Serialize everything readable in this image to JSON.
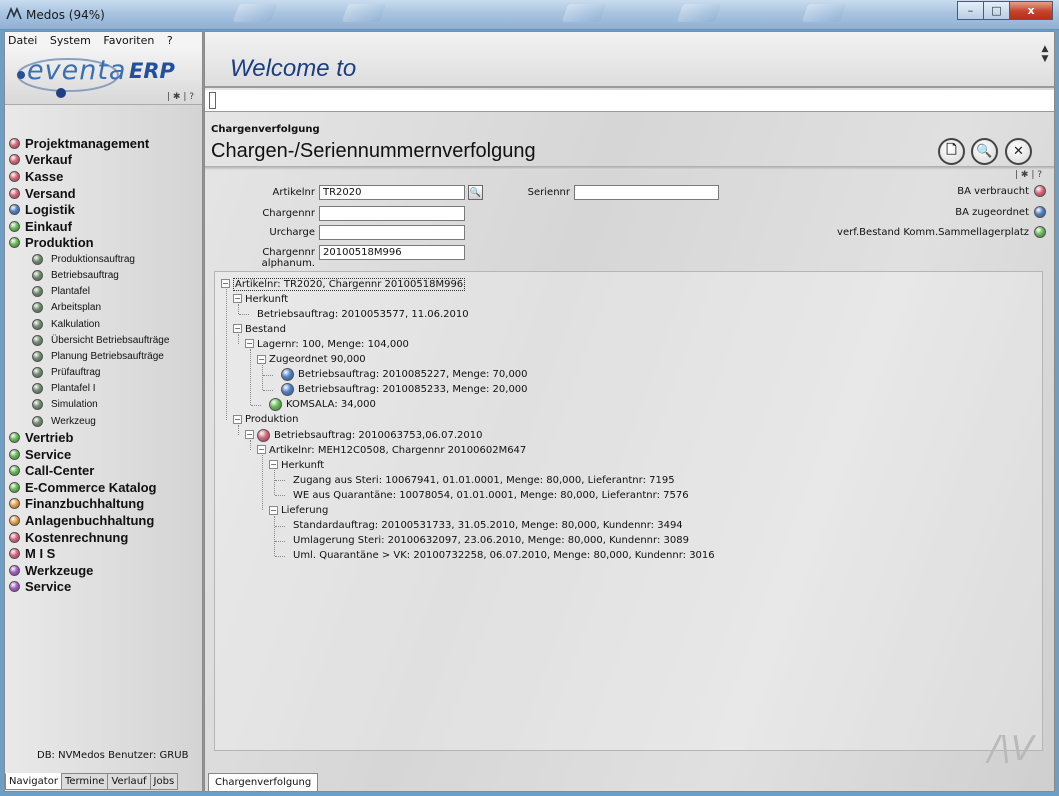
{
  "window": {
    "title": "Medos (94%)",
    "min_symbol": "–",
    "max_symbol": "□",
    "close_symbol": "x"
  },
  "menu": [
    "Datei",
    "System",
    "Favoriten",
    "?"
  ],
  "logo": {
    "brand": "eventa",
    "erp": "ERP"
  },
  "toolstrip": "| ✱ | ?",
  "colors": {
    "pink": "#d9667a",
    "blue": "#4f7fc6",
    "green": "#66bb55",
    "orange": "#e8a24a",
    "purple": "#a85cc3",
    "gray_green": "#6e8f6e"
  },
  "navigator": {
    "items": [
      {
        "label": "Projektmanagement",
        "color": "#d9667a",
        "sub": false
      },
      {
        "label": "Verkauf",
        "color": "#d9667a",
        "sub": false
      },
      {
        "label": "Kasse",
        "color": "#d9667a",
        "sub": false
      },
      {
        "label": "Versand",
        "color": "#d9667a",
        "sub": false
      },
      {
        "label": "Logistik",
        "color": "#4f7fc6",
        "sub": false
      },
      {
        "label": "Einkauf",
        "color": "#66bb55",
        "sub": false
      },
      {
        "label": "Produktion",
        "color": "#66bb55",
        "sub": false
      },
      {
        "label": "Produktionsauftrag",
        "color": "#6e8f6e",
        "sub": true
      },
      {
        "label": "Betriebsauftrag",
        "color": "#6e8f6e",
        "sub": true
      },
      {
        "label": "Plantafel",
        "color": "#6e8f6e",
        "sub": true
      },
      {
        "label": "Arbeitsplan",
        "color": "#6e8f6e",
        "sub": true
      },
      {
        "label": "Kalkulation",
        "color": "#6e8f6e",
        "sub": true
      },
      {
        "label": "Übersicht Betriebsaufträge",
        "color": "#6e8f6e",
        "sub": true
      },
      {
        "label": "Planung Betriebsaufträge",
        "color": "#6e8f6e",
        "sub": true
      },
      {
        "label": "Prüfauftrag",
        "color": "#6e8f6e",
        "sub": true
      },
      {
        "label": "Plantafel I",
        "color": "#6e8f6e",
        "sub": true
      },
      {
        "label": "Simulation",
        "color": "#6e8f6e",
        "sub": true
      },
      {
        "label": "Werkzeug",
        "color": "#6e8f6e",
        "sub": true
      },
      {
        "label": "Vertrieb",
        "color": "#66bb55",
        "sub": false
      },
      {
        "label": "Service",
        "color": "#66bb55",
        "sub": false
      },
      {
        "label": "Call-Center",
        "color": "#66bb55",
        "sub": false
      },
      {
        "label": "E-Commerce Katalog",
        "color": "#66bb55",
        "sub": false
      },
      {
        "label": "Finanzbuchhaltung",
        "color": "#e8a24a",
        "sub": false
      },
      {
        "label": "Anlagenbuchhaltung",
        "color": "#e8a24a",
        "sub": false
      },
      {
        "label": "Kostenrechnung",
        "color": "#d9667a",
        "sub": false
      },
      {
        "label": "M I S",
        "color": "#d9667a",
        "sub": false
      },
      {
        "label": "Werkzeuge",
        "color": "#a85cc3",
        "sub": false
      },
      {
        "label": "Service",
        "color": "#a85cc3",
        "sub": false
      }
    ],
    "db_status": "DB: NVMedos  Benutzer: GRUB",
    "tabs": [
      "Navigator",
      "Termine",
      "Verlauf",
      "Jobs"
    ]
  },
  "welcome": {
    "title": "Welcome to",
    "scroll_up": "▲",
    "scroll_down": "▼"
  },
  "section": {
    "label": "Chargenverfolgung",
    "title": "Chargen-/Seriennummernverfolgung"
  },
  "toolbar": {
    "new_symbol": "🗋",
    "search_symbol": "🔍",
    "close_symbol": "✕"
  },
  "form": {
    "artikelnr_label": "Artikelnr",
    "artikelnr_value": "TR2020",
    "seriennr_label": "Seriennr",
    "seriennr_value": "",
    "chargennr_label": "Chargennr",
    "chargennr_value": "",
    "urcharge_label": "Urcharge",
    "urcharge_value": "",
    "alphanum_label": "Chargennr alphanum.",
    "alphanum_value": "20100518M996",
    "search_symbol": "🔍"
  },
  "legend": [
    {
      "label": "BA verbraucht",
      "color": "#d9667a"
    },
    {
      "label": "BA zugeordnet",
      "color": "#4f7fc6"
    },
    {
      "label": "verf.Bestand Komm.Sammellagerplatz",
      "color": "#66bb55"
    }
  ],
  "tree": [
    {
      "text": "Artikelnr: TR2020, Chargennr 20100518M996",
      "level": 0,
      "toggle": "−",
      "ball": null
    },
    {
      "text": "Herkunft",
      "level": 1,
      "toggle": "−",
      "ball": null
    },
    {
      "text": "Betriebsauftrag: 2010053577, 11.06.2010",
      "level": 2,
      "toggle": null,
      "ball": null
    },
    {
      "text": "Bestand",
      "level": 1,
      "toggle": "−",
      "ball": null
    },
    {
      "text": "Lagernr: 100, Menge: 104,000",
      "level": 2,
      "toggle": "−",
      "ball": null
    },
    {
      "text": "Zugeordnet 90,000",
      "level": 3,
      "toggle": "−",
      "ball": null
    },
    {
      "text": "Betriebsauftrag: 2010085227, Menge: 70,000",
      "level": 4,
      "toggle": null,
      "ball": "#4f7fc6"
    },
    {
      "text": "Betriebsauftrag: 2010085233, Menge: 20,000",
      "level": 4,
      "toggle": null,
      "ball": "#4f7fc6"
    },
    {
      "text": "KOMSALA: 34,000",
      "level": 3,
      "toggle": null,
      "ball": "#66bb55"
    },
    {
      "text": "Produktion",
      "level": 1,
      "toggle": "−",
      "ball": null
    },
    {
      "text": "Betriebsauftrag: 2010063753,06.07.2010",
      "level": 2,
      "toggle": "−",
      "ball": "#d9667a"
    },
    {
      "text": "Artikelnr: MEH12C0508, Chargennr 20100602M647",
      "level": 3,
      "toggle": "−",
      "ball": null
    },
    {
      "text": "Herkunft",
      "level": 4,
      "toggle": "−",
      "ball": null
    },
    {
      "text": "Zugang aus Steri: 10067941, 01.01.0001, Menge: 80,000, Lieferantnr: 7195",
      "level": 5,
      "toggle": null,
      "ball": null
    },
    {
      "text": "WE aus Quarantäne: 10078054, 01.01.0001, Menge: 80,000, Lieferantnr: 7576",
      "level": 5,
      "toggle": null,
      "ball": null
    },
    {
      "text": "Lieferung",
      "level": 4,
      "toggle": "−",
      "ball": null
    },
    {
      "text": "Standardauftrag: 20100531733, 31.05.2010, Menge: 80,000, Kundennr: 3494",
      "level": 5,
      "toggle": null,
      "ball": null
    },
    {
      "text": "Umlagerung Steri: 20100632097, 23.06.2010, Menge: 80,000, Kundennr: 3089",
      "level": 5,
      "toggle": null,
      "ball": null
    },
    {
      "text": "Uml. Quarantäne > VK: 20100732258, 06.07.2010, Menge: 80,000, Kundennr: 3016",
      "level": 5,
      "toggle": null,
      "ball": null
    }
  ],
  "bottom_tab": "Chargenverfolgung"
}
